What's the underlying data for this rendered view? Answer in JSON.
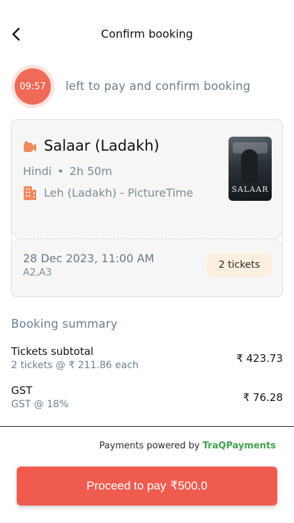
{
  "header": {
    "title": "Confirm booking",
    "back_icon": "chevron-left-icon"
  },
  "timer": {
    "remaining": "09:57",
    "message": "left to pay and confirm booking",
    "colors": {
      "ring": "#fde3dd",
      "fill": "#ef6a57"
    }
  },
  "ticket": {
    "movie_icon": "movie-camera-icon",
    "movie_title": "Salaar (Ladakh)",
    "language": "Hindi",
    "separator": "•",
    "duration": "2h 50m",
    "cinema_icon": "building-icon",
    "cinema": "Leh (Ladakh) - PictureTime",
    "poster_text": "SALAAR",
    "show_datetime": "28 Dec 2023, 11:00 AM",
    "seats": "A2,A3",
    "tickets_count": "2 tickets"
  },
  "summary": {
    "heading": "Booking summary",
    "lines": [
      {
        "label": "Tickets subtotal",
        "sub": "2 tickets @ ₹ 211.86 each",
        "amount": "₹ 423.73"
      },
      {
        "label": "GST",
        "sub": "GST @ 18%",
        "amount": "₹ 76.28"
      }
    ]
  },
  "footer": {
    "powered_prefix": "Payments powered by",
    "powered_brand": "TraQPayments",
    "pay_label": "Proceed to pay",
    "pay_amount": "₹500.0"
  },
  "colors": {
    "accent": "#ef5c4f",
    "brand_green": "#3ea24b",
    "muted_text": "#6a7f8e"
  }
}
